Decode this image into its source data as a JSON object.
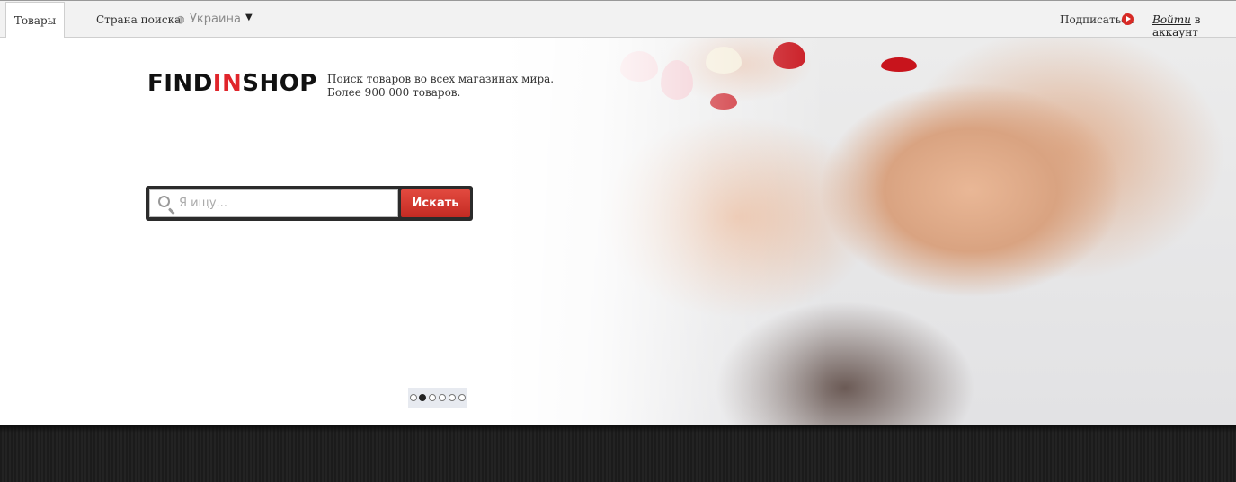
{
  "topbar": {
    "tab_products": "Товары",
    "country_label": "Страна поиска",
    "country_value": "Украина",
    "subscribe_label": "Подписаться",
    "login_link": "Войти",
    "login_suffix": " в аккаунт"
  },
  "hero": {
    "logo_part1": "FIND",
    "logo_part2": "IN",
    "logo_part3": "SHOP",
    "tagline_line1": "Поиск товаров во всех магазинах мира.",
    "tagline_line2": "Более 900 000 товаров.",
    "search": {
      "placeholder": "Я ищу...",
      "value": "",
      "button_label": "Искать"
    },
    "slider": {
      "count": 6,
      "active_index": 1
    }
  },
  "colors": {
    "brand_red": "#e0252b",
    "button_red": "#c42b23",
    "dark_band": "#1b1b1b"
  },
  "icons": [
    "globe-icon",
    "dropdown-arrow-icon",
    "youtube-play-icon",
    "search-icon"
  ]
}
